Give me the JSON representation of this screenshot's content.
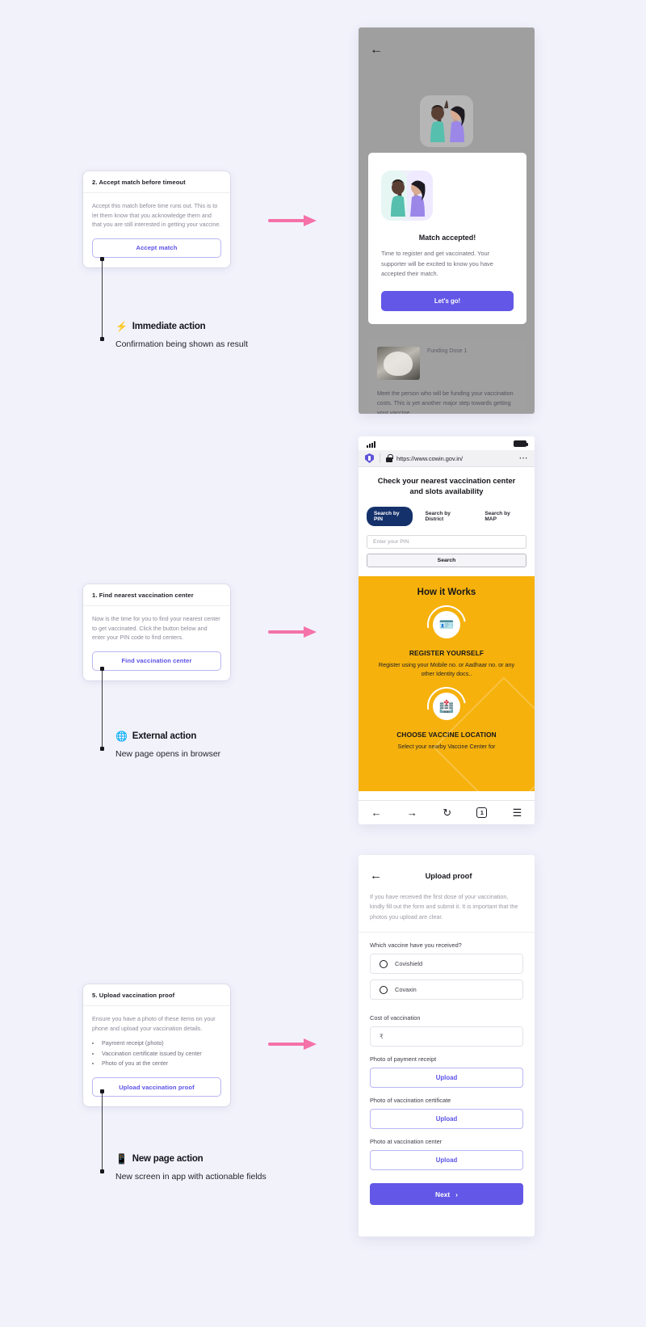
{
  "sections": [
    {
      "card": {
        "title": "2. Accept match before timeout",
        "desc": "Accept this match before time runs out. This is to let them know that you acknowledge them and that you are still interested in getting your vaccine.",
        "button": "Accept match"
      },
      "annotation": {
        "emoji": "⚡",
        "icon_name": "lightning-bolt-icon",
        "title": "Immediate action",
        "sub": "Confirmation being shown as result"
      }
    },
    {
      "card": {
        "title": "1. Find nearest vaccination center",
        "desc": "Now is the time for you to find your nearest center to get vaccinated. Click the button below and enter your PIN code to find centers.",
        "button": "Find vaccination center"
      },
      "annotation": {
        "emoji": "🌐",
        "icon_name": "globe-icon",
        "title": "External action",
        "sub": "New page opens in browser"
      }
    },
    {
      "card": {
        "title": "5. Upload vaccination proof",
        "desc": "Ensure you have a photo of these items on your phone and upload your vaccination details.",
        "list": [
          "Payment receipt (photo)",
          "Vaccination certificate issued by center",
          "Photo of you at the center"
        ],
        "button": "Upload vaccination proof"
      },
      "annotation": {
        "emoji": "📱",
        "icon_name": "mobile-phone-icon",
        "title": "New page action",
        "sub": "New screen in app with actionable fields"
      }
    }
  ],
  "device_match": {
    "back_icon": "←",
    "modal": {
      "title": "Match accepted!",
      "text": "Time to register and get vaccinated. Your supporter will be excited to know you have accepted their match.",
      "cta": "Let's go!"
    },
    "behind_card": {
      "label": "Funding Dose 1",
      "text": "Meet the person who will be funding your vaccination costs. This is yet another major step towards getting your vaccine."
    }
  },
  "device_browser": {
    "url": "https://www.cowin.gov.in/",
    "menu_icon": "⋯",
    "heading": "Check your nearest vaccination center and slots availability",
    "tabs": [
      {
        "label": "Search by PIN",
        "active": true
      },
      {
        "label": "Search by District",
        "active": false
      },
      {
        "label": "Search by MAP",
        "active": false
      }
    ],
    "pin_placeholder": "Enter your PIN",
    "search_button": "Search",
    "how_it_works_title": "How it Works",
    "steps": [
      {
        "icon": "🪪",
        "title": "REGISTER YOURSELF",
        "desc": "Register using your Mobile no. or Aadhaar no. or any other Identity docs.."
      },
      {
        "icon": "🏥",
        "title": "CHOOSE VACCINE LOCATION",
        "desc": "Select your nearby Vaccine Center for"
      }
    ],
    "nav": {
      "back": "←",
      "forward": "→",
      "reload": "↻",
      "tab_count": "1",
      "menu": "☰"
    }
  },
  "device_upload": {
    "back_icon": "←",
    "title": "Upload proof",
    "intro": "If you have received the first dose of your vaccination, kindly fill out the form and submit it. It is important that the photos you upload are clear.",
    "vaccine_question": "Which vaccine have you received?",
    "vaccine_options": [
      "Covishield",
      "Covaxin"
    ],
    "cost_label": "Cost of vaccination",
    "cost_value": "₹",
    "uploads": [
      {
        "label": "Photo of payment receipt",
        "button": "Upload"
      },
      {
        "label": "Photo of vaccination certificate",
        "button": "Upload"
      },
      {
        "label": "Photo at vaccination center",
        "button": "Upload"
      }
    ],
    "next_button": "Next",
    "next_icon": "›"
  },
  "colors": {
    "background": "#f2f2fb",
    "accent_purple": "#6257e6",
    "arrow_pink": "#f472a8",
    "cowin_yellow": "#f6b10c",
    "cowin_navy": "#15316b"
  }
}
